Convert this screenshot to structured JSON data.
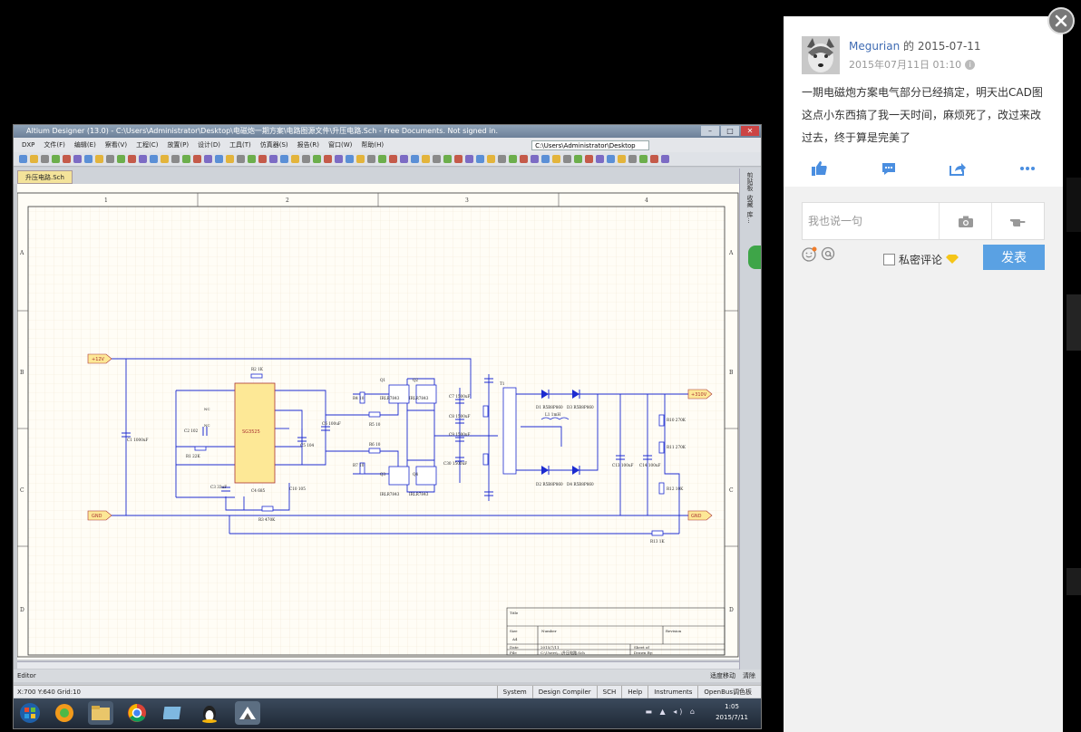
{
  "colors": {
    "accent": "#5aa1e3",
    "link": "#3f6bb3",
    "wire": "#1c2bd0",
    "part_fill": "#fde896",
    "part_stroke": "#a33",
    "sheet_grid": "#f1e8d4"
  },
  "altium": {
    "window_title": "Altium Designer (13.0) - C:\\Users\\Administrator\\Desktop\\电磁炮一期方案\\电路图源文件\\升压电路.Sch - Free Documents. Not signed in.",
    "menu_items": [
      "DXP",
      "文件(F)",
      "编辑(E)",
      "察看(V)",
      "工程(C)",
      "放置(P)",
      "设计(D)",
      "工具(T)",
      "仿真器(S)",
      "报告(R)",
      "窗口(W)",
      "帮助(H)"
    ],
    "path_field": "C:\\Users\\Administrator\\Desktop",
    "doc_tab": "升压电路.Sch",
    "side_panels": [
      "剪贴板",
      "收藏",
      "库..."
    ],
    "editor_label": "Editor",
    "editor_right": [
      "适度移动",
      "清除"
    ],
    "status_coords": "X:700 Y:640   Grid:10",
    "status_tabs": [
      "System",
      "Design Compiler",
      "SCH",
      "Help",
      "Instruments",
      "OpenBus调色板"
    ],
    "clock_time": "1:05",
    "clock_date": "2015/7/11"
  },
  "schematic": {
    "zone_cols": [
      "1",
      "2",
      "3",
      "4"
    ],
    "zone_rows": [
      "A",
      "B",
      "C",
      "D"
    ],
    "ic_label": "SG3525",
    "ports": [
      "+12V",
      "GND",
      "+310V",
      "GND"
    ],
    "components": {
      "R2": "R2   1K",
      "C1": "C1 1000uF",
      "C2": "C2   102",
      "R1": "R1   22K",
      "C3": "C3 33uF",
      "C4": "C4   685",
      "C10": "C10 105",
      "R3": "R3   470K",
      "C5": "C5 104",
      "C6": "C6 100uF",
      "R4": "R4 10",
      "R5": "R5 10",
      "R6": "R6 10",
      "R7": "R7 10",
      "Q1": "Q1",
      "Q2": "Q2",
      "Q3": "Q3",
      "Q4": "Q4",
      "IRLR": "IRLR7843",
      "C7": "C7 1500uF",
      "C8": "C8 1500uF",
      "C9": "C9 1500uF",
      "C30": "C30 1500uF",
      "T1": "T1",
      "D1": "D1 R5B8P860",
      "D3": "D3 R5B8P860",
      "D2": "D2 R5B8P860",
      "D4": "D4 R5B8P860",
      "L1": "L1 1mH",
      "C13": "C13 100uF",
      "C14": "C14 100uF",
      "R10": "R10 270K",
      "R11": "R11 270K",
      "R12": "R12 10K",
      "R13": "R13 1K",
      "NC": "NC"
    },
    "title_block": {
      "title": "Title",
      "size_label": "Size",
      "size": "A4",
      "number_label": "Number",
      "revision_label": "Revision",
      "date_label": "Date",
      "date": "2015/7/11",
      "file_label": "File",
      "file": "C:\\Users\\...\\升压电路.Sch",
      "sheet_label": "Sheet   of",
      "drawn_label": "Drawn By:"
    }
  },
  "post": {
    "author": "Megurian",
    "author_suffix": " 的 2015-07-11",
    "timestamp": "2015年07月11日 01:10",
    "text": "一期电磁炮方案电气部分已经搞定，明天出CAD图 这点小东西搞了我一天时间，麻烦死了，改过来改过去，终于算是完美了",
    "comment_placeholder": "我也说一句",
    "private_label": "私密评论",
    "submit_label": "发表"
  }
}
